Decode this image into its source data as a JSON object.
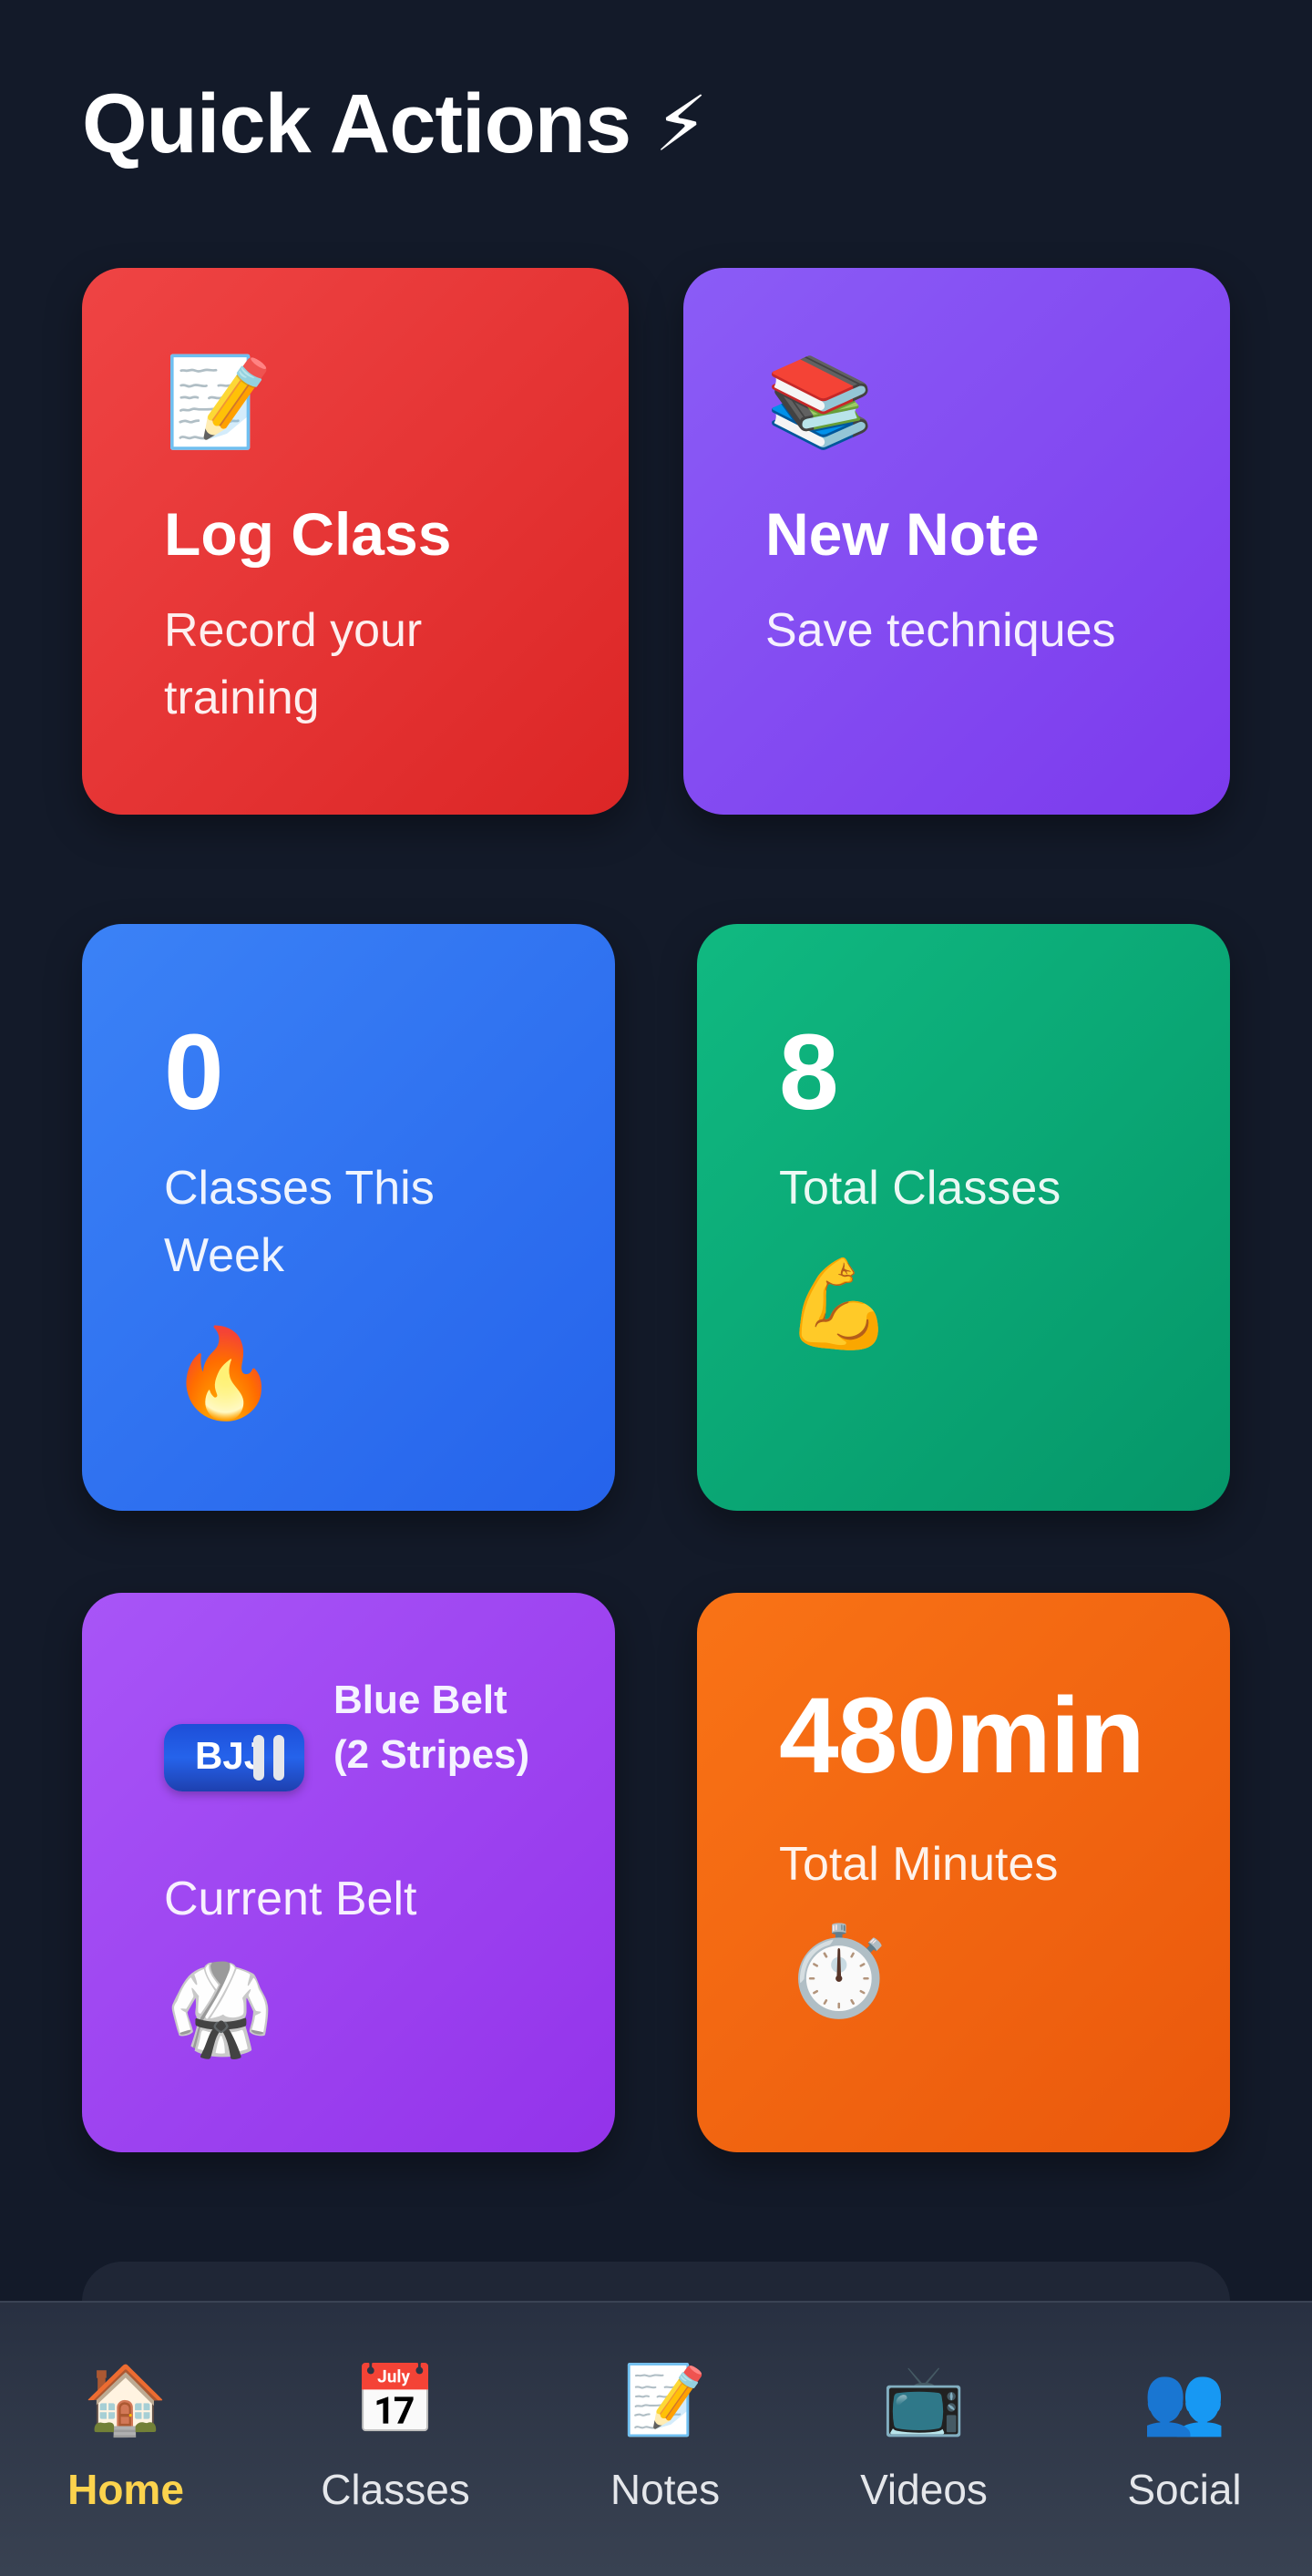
{
  "header": {
    "title": "Quick Actions",
    "title_icon": "⚡"
  },
  "actions": {
    "log_class": {
      "icon": "📝",
      "title": "Log Class",
      "subtitle": "Record your training"
    },
    "new_note": {
      "icon": "📚",
      "title": "New Note",
      "subtitle": "Save techniques"
    }
  },
  "stats": {
    "classes_week": {
      "value": "0",
      "label": "Classes This Week",
      "icon": "🔥"
    },
    "total_classes": {
      "value": "8",
      "label": "Total Classes",
      "icon": "💪"
    },
    "current_belt": {
      "belt_text": "BJJ",
      "belt_name": "Blue Belt (2 Stripes)",
      "label": "Current Belt",
      "icon": "🥋",
      "belt_color": "#2563eb",
      "stripes": 2
    },
    "total_minutes": {
      "value": "480min",
      "label": "Total Minutes",
      "icon": "⏱️"
    }
  },
  "nav": {
    "items": [
      {
        "label": "Home",
        "icon": "🏠",
        "active": true
      },
      {
        "label": "Classes",
        "icon": "📅",
        "active": false
      },
      {
        "label": "Notes",
        "icon": "📝",
        "active": false
      },
      {
        "label": "Videos",
        "icon": "📺",
        "active": false
      },
      {
        "label": "Social",
        "icon": "👥",
        "active": false
      }
    ]
  },
  "colors": {
    "background": "#131a29",
    "log_class": "#ef4444",
    "new_note": "#8b5cf6",
    "classes_week": "#3b82f6",
    "total_classes": "#10b981",
    "current_belt": "#a855f7",
    "total_minutes": "#f97316",
    "nav_active": "#fcd34d"
  }
}
